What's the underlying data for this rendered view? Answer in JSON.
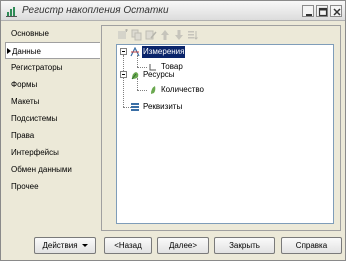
{
  "window": {
    "title": "Регистр накопления Остатки"
  },
  "nav": {
    "items": [
      {
        "label": "Основные",
        "active": false
      },
      {
        "label": "Данные",
        "active": true
      },
      {
        "label": "Регистраторы",
        "active": false
      },
      {
        "label": "Формы",
        "active": false
      },
      {
        "label": "Макеты",
        "active": false
      },
      {
        "label": "Подсистемы",
        "active": false
      },
      {
        "label": "Права",
        "active": false
      },
      {
        "label": "Интерфейсы",
        "active": false
      },
      {
        "label": "Обмен данными",
        "active": false
      },
      {
        "label": "Прочее",
        "active": false
      }
    ]
  },
  "tree": {
    "dimensions": {
      "label": "Измерения",
      "children": [
        "Товар"
      ]
    },
    "resources": {
      "label": "Ресурсы",
      "children": [
        "Количество"
      ]
    },
    "attributes": {
      "label": "Реквизиты"
    }
  },
  "buttons": {
    "actions": "Действия",
    "back": "<Назад",
    "next": "Далее>",
    "close": "Закрыть",
    "help": "Справка"
  },
  "colors": {
    "selection": "#0a246a",
    "window_bg": "#ece9d8"
  }
}
